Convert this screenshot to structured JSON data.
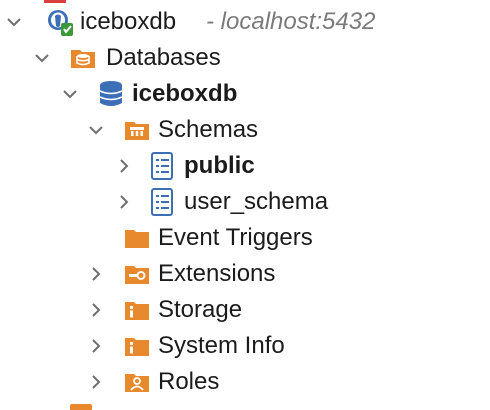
{
  "tree": {
    "server": {
      "name": "iceboxdb",
      "host": "- localhost:5432",
      "icon": "postgres-elephant-icon"
    },
    "databases": {
      "label": "Databases"
    },
    "database": {
      "label": "iceboxdb"
    },
    "schemas": {
      "label": "Schemas"
    },
    "schema_items": [
      {
        "label": "public"
      },
      {
        "label": "user_schema"
      }
    ],
    "db_children": [
      {
        "label": "Event Triggers",
        "icon": "folder-icon"
      },
      {
        "label": "Extensions",
        "icon": "extensions-folder-icon"
      },
      {
        "label": "Storage",
        "icon": "info-folder-icon"
      },
      {
        "label": "System Info",
        "icon": "info-folder-icon"
      },
      {
        "label": "Roles",
        "icon": "user-folder-icon"
      }
    ]
  },
  "colors": {
    "folder": "#e8892e",
    "db_blue": "#3d6fb6",
    "chevron": "#6e6e6e",
    "host_text": "#7a7a7a"
  }
}
